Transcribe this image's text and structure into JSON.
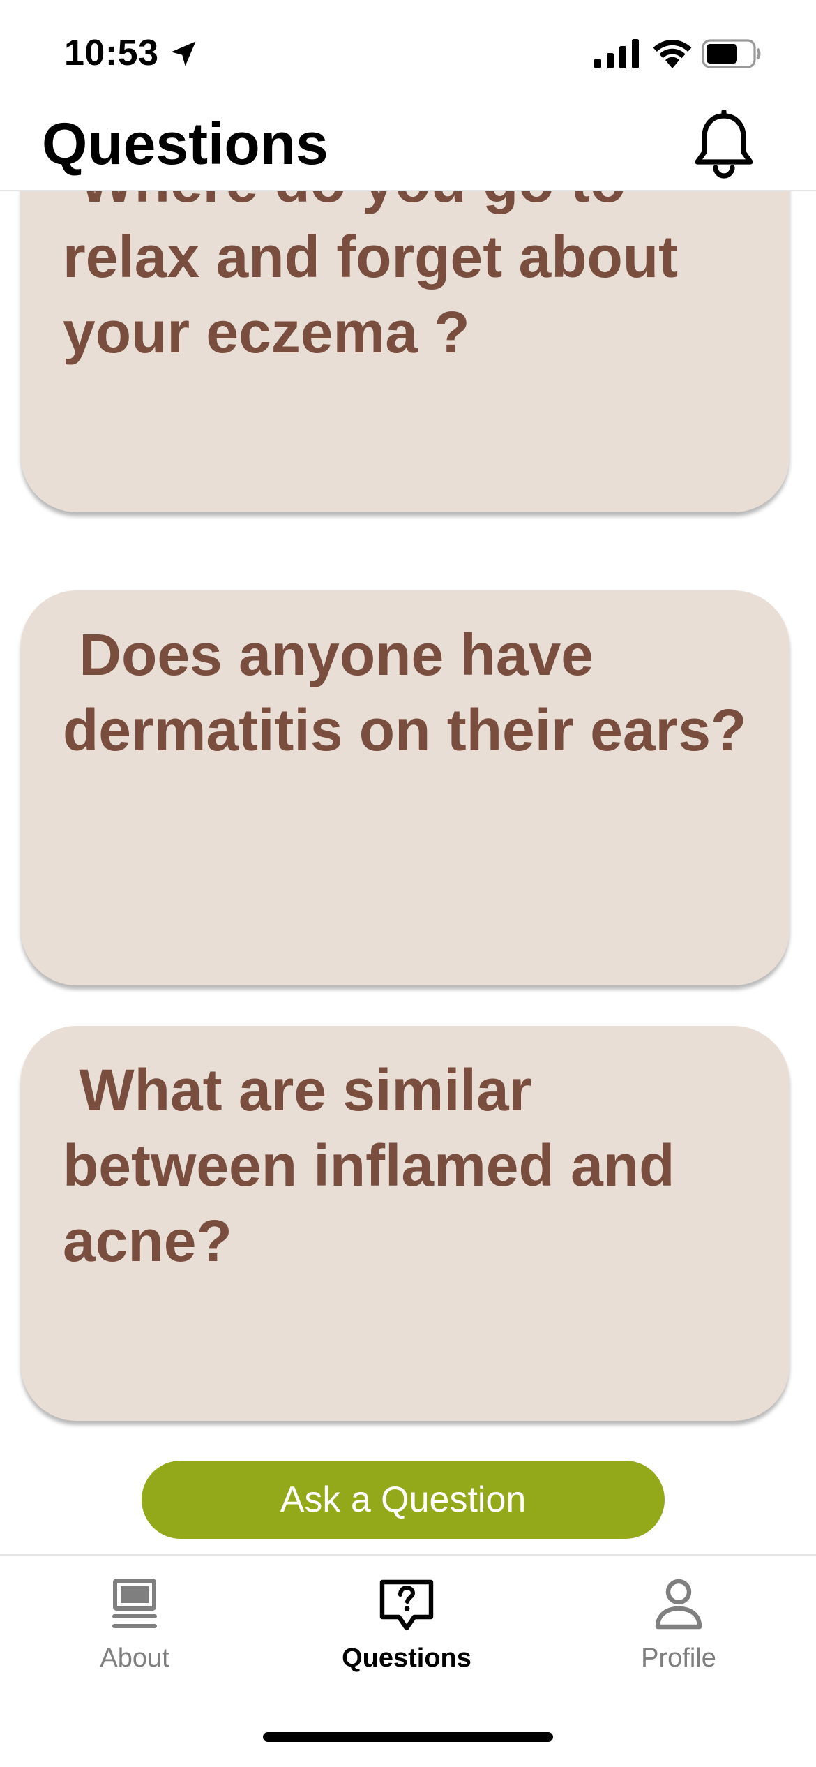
{
  "status_bar": {
    "time": "10:53"
  },
  "header": {
    "title": "Questions"
  },
  "questions": [
    " Where do you go to relax and forget about your eczema ?",
    " Does anyone have dermatitis on their ears?",
    " What are similar between inflamed and acne?"
  ],
  "ask_button": {
    "label": "Ask a Question"
  },
  "tabs": [
    {
      "label": "About",
      "icon": "laptop-icon",
      "active": false
    },
    {
      "label": "Questions",
      "icon": "question-bubble-icon",
      "active": true
    },
    {
      "label": "Profile",
      "icon": "person-icon",
      "active": false
    }
  ],
  "colors": {
    "card_bg": "#e8ded5",
    "card_text": "#7a4e3f",
    "accent_button": "#93a91a",
    "tab_inactive": "#7f7f7f"
  }
}
